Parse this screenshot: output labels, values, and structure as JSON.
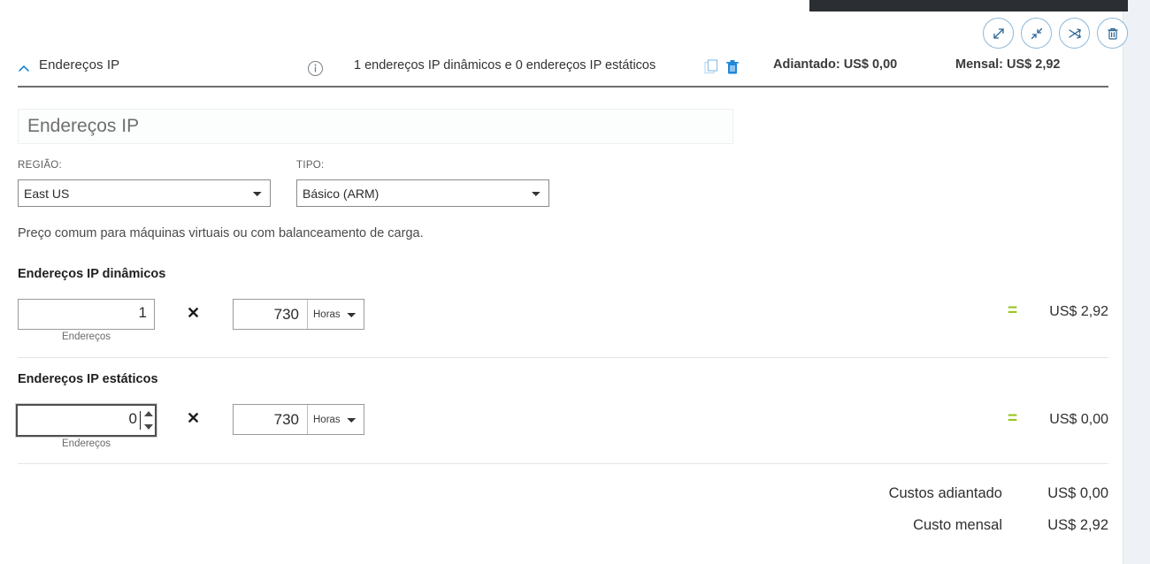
{
  "toolbar": {
    "buttons": [
      {
        "name": "expand-icon",
        "title": "Expandir"
      },
      {
        "name": "collapse-icon",
        "title": "Recolher"
      },
      {
        "name": "shuffle-icon",
        "title": "Mover"
      },
      {
        "name": "trash-icon",
        "title": "Excluir"
      }
    ]
  },
  "header": {
    "chevron": "chevron-up-icon",
    "title": "Endereços IP",
    "info_icon": "info-icon",
    "summary": "1 endereços IP dinâmicos e 0 endereços IP estáticos",
    "copy_icon": "copy-icon",
    "delete_icon": "trash-icon",
    "upfront": "Adiantado: US$ 0,00",
    "monthly": "Mensal: US$ 2,92"
  },
  "name_field": {
    "value": "Endereços IP",
    "placeholder": "Endereços IP"
  },
  "region": {
    "label": "REGIÃO:",
    "selected": "East US",
    "options": [
      "East US"
    ]
  },
  "type": {
    "label": "TIPO:",
    "selected": "Básico (ARM)",
    "options": [
      "Básico (ARM)"
    ]
  },
  "description": "Preço comum para máquinas virtuais ou com balanceamento de carga.",
  "rows": [
    {
      "label": "Endereços IP dinâmicos",
      "qty": "1",
      "qty_sublabel": "Endereços",
      "operator": "✕",
      "hours": "730",
      "unit": "Horas",
      "unit_options": [
        "Horas"
      ],
      "equals": "=",
      "price": "US$ 2,92",
      "focused": false
    },
    {
      "label": "Endereços IP estáticos",
      "qty": "0",
      "qty_sublabel": "Endereços",
      "operator": "✕",
      "hours": "730",
      "unit": "Horas",
      "unit_options": [
        "Horas"
      ],
      "equals": "=",
      "price": "US$ 0,00",
      "focused": true
    }
  ],
  "totals": [
    {
      "label": "Custos adiantado",
      "value": "US$ 0,00"
    },
    {
      "label": "Custo mensal",
      "value": "US$ 2,92"
    }
  ],
  "colors": {
    "accent_blue": "#0078d4",
    "icon_blue": "#2a6496",
    "equals_green": "#9ac521",
    "page_bg": "#eef1f5",
    "card_bg": "#ffffff",
    "dark_bar": "#2b2f33"
  }
}
